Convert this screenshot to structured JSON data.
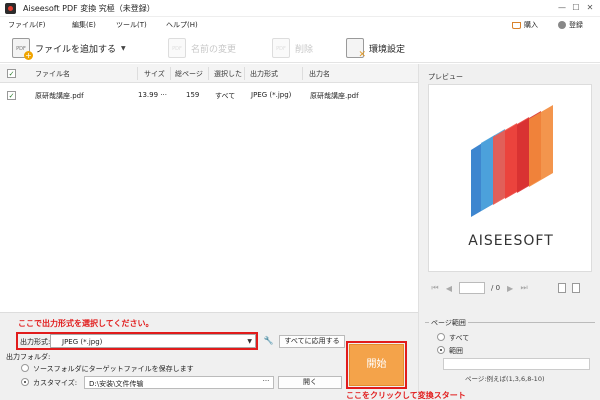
{
  "window": {
    "title": "Aiseesoft PDF 変換 究極（未登録）"
  },
  "menu": {
    "items": [
      "ファイル(F)",
      "編集(E)",
      "ツール(T)",
      "ヘルプ(H)"
    ],
    "purchase": "購入",
    "register": "登録"
  },
  "toolbar": {
    "add_file": "ファイルを追加する",
    "rename": "名前の変更",
    "delete": "削除",
    "settings": "環境設定"
  },
  "file_list": {
    "headers": [
      "ファイル名",
      "サイズ",
      "総ページ",
      "選択した",
      "出力形式",
      "出力名"
    ],
    "rows": [
      {
        "name": "原研哉講座.pdf",
        "size": "13.99 ···",
        "pages": "159",
        "selected": "すべて",
        "format": "JPEG (*.jpg)",
        "output_name": "原研哉講座.pdf"
      }
    ]
  },
  "preview": {
    "title": "プレビュー",
    "brand": "AISEESOFT",
    "page_total": "/ 0",
    "range_title": "ページ範囲",
    "range_all": "すべて",
    "range_custom": "範囲",
    "range_hint": "ページ:例えば(1,3,6,8-10)"
  },
  "output": {
    "annotation_format": "ここで出力形式を選択してください。",
    "format_label": "出力形式:",
    "format_value": "JPEG (*.jpg)",
    "apply_all": "すべてに応用する",
    "folder_label": "出力フォルダ:",
    "source_folder_option": "ソースフォルダにターゲットファイルを保存します",
    "custom_option": "カスタマイズ:",
    "custom_path": "D:\\安装\\文件传输",
    "browse": "···",
    "open": "開く",
    "start": "開始",
    "annotation_start": "ここをクリックして変換スタート"
  },
  "colors": {
    "accent": "#f4a34a",
    "annotation": "#e11c1c"
  }
}
